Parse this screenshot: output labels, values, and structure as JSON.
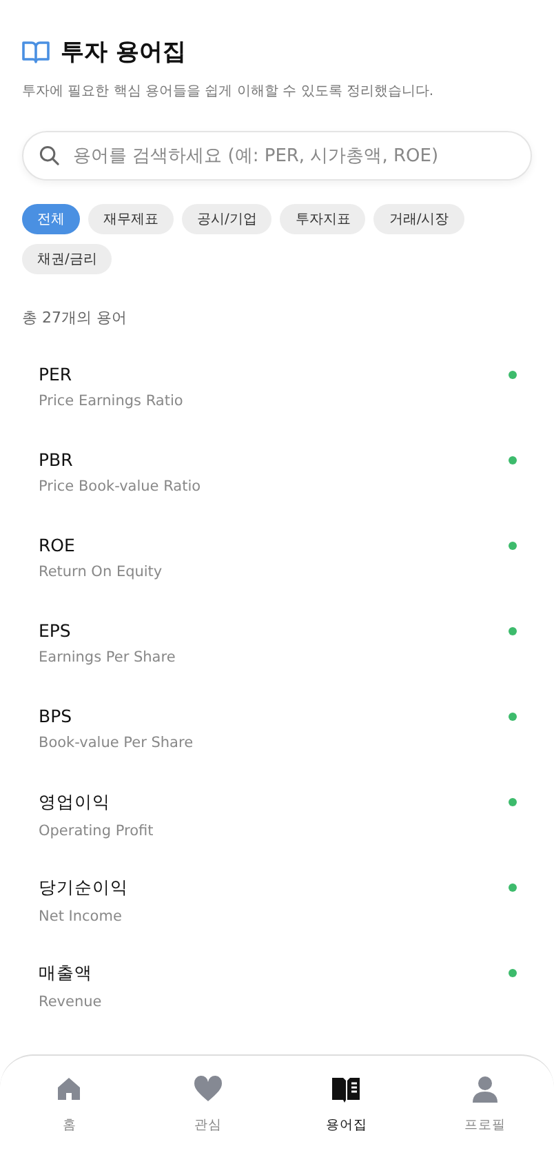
{
  "header": {
    "title": "투자 용어집",
    "subtitle": "투자에 필요한 핵심 용어들을 쉽게 이해할 수 있도록 정리했습니다."
  },
  "search": {
    "placeholder": "용어를 검색하세요 (예: PER, 시가총액, ROE)"
  },
  "categories": [
    {
      "label": "전체",
      "selected": true
    },
    {
      "label": "재무제표",
      "selected": false
    },
    {
      "label": "공시/기업",
      "selected": false
    },
    {
      "label": "투자지표",
      "selected": false
    },
    {
      "label": "거래/시장",
      "selected": false
    },
    {
      "label": "채권/금리",
      "selected": false
    }
  ],
  "count": "총 27개의 용어",
  "terms": [
    {
      "term": "PER",
      "full": "Price Earnings Ratio",
      "color": "#3dbb6c"
    },
    {
      "term": "PBR",
      "full": "Price Book-value Ratio",
      "color": "#3dbb6c"
    },
    {
      "term": "ROE",
      "full": "Return On Equity",
      "color": "#3dbb6c"
    },
    {
      "term": "EPS",
      "full": "Earnings Per Share",
      "color": "#3dbb6c"
    },
    {
      "term": "BPS",
      "full": "Book-value Per Share",
      "color": "#3dbb6c"
    },
    {
      "term": "영업이익",
      "full": "Operating Profit",
      "color": "#3dbb6c"
    },
    {
      "term": "당기순이익",
      "full": "Net Income",
      "color": "#3dbb6c"
    },
    {
      "term": "매출액",
      "full": "Revenue",
      "color": "#3dbb6c"
    }
  ],
  "nav": [
    {
      "kind": "home",
      "label": "홈",
      "selected": false
    },
    {
      "kind": "heart",
      "label": "관심",
      "selected": false
    },
    {
      "kind": "book",
      "label": "용어집",
      "selected": true
    },
    {
      "kind": "person",
      "label": "프로필",
      "selected": false
    }
  ]
}
